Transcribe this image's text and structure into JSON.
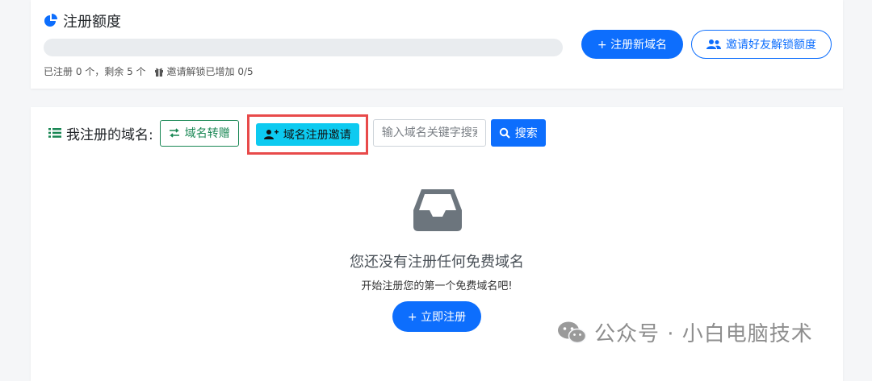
{
  "quota": {
    "title": "注册额度",
    "progress_fraction": 0,
    "status_text": "已注册 0 个，剩余 5 个",
    "invite_text": "邀请解锁已增加 0/5",
    "register_button": "+ 注册新域名",
    "invite_friends_button": "邀请好友解锁额度"
  },
  "domains": {
    "title": "我注册的域名:",
    "transfer_button": "域名转赠",
    "invite_register_button": "域名注册邀请",
    "search_placeholder": "输入域名关键字搜索",
    "search_button": "搜索",
    "empty_title": "您还没有注册任何免费域名",
    "empty_subtitle": "开始注册您的第一个免费域名吧!",
    "register_now_button": "+ 立即注册"
  },
  "watermark": {
    "text": "公众号 · 小白电脑技术"
  },
  "colors": {
    "primary": "#0d6efd",
    "success": "#198754",
    "info": "#0dcaf0",
    "highlight": "#e84a4a"
  },
  "icons": [
    "pie-chart-icon",
    "gift-icon",
    "users-icon",
    "list-icon",
    "exchange-icon",
    "user-plus-icon",
    "search-icon",
    "inbox-icon",
    "wechat-icon"
  ]
}
